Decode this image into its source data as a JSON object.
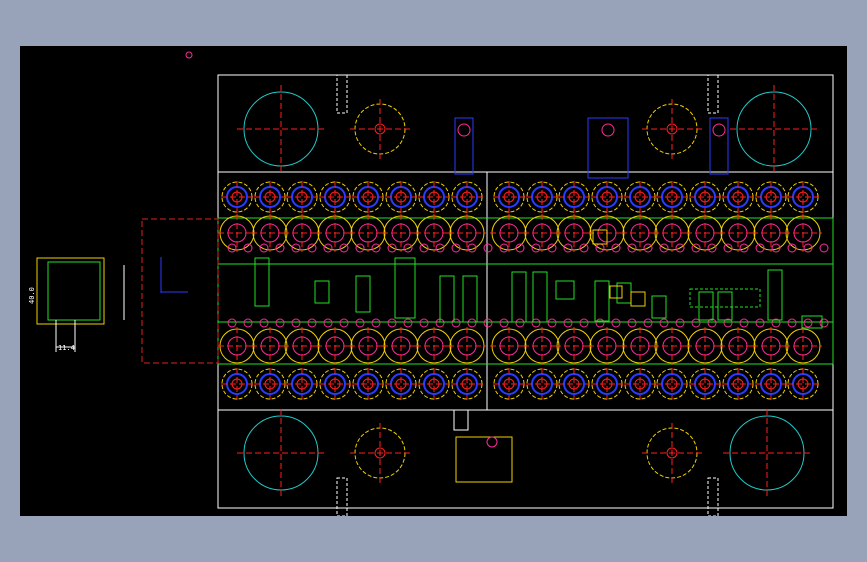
{
  "viewport": {
    "background": "#98a2b8",
    "canvas_background": "#000000"
  },
  "drawing": {
    "palette": {
      "outline": "#ffffff",
      "center_line": "#ff2020",
      "large_circle": "#22c8c8",
      "bolt": "#2a3cff",
      "ring": "#f0d000",
      "strip": "#22e022",
      "marker": "#ff2a9a",
      "blank_frame": "#e02020"
    },
    "dimensions": {
      "width_label": "40.0",
      "height_label": "11.4"
    }
  }
}
